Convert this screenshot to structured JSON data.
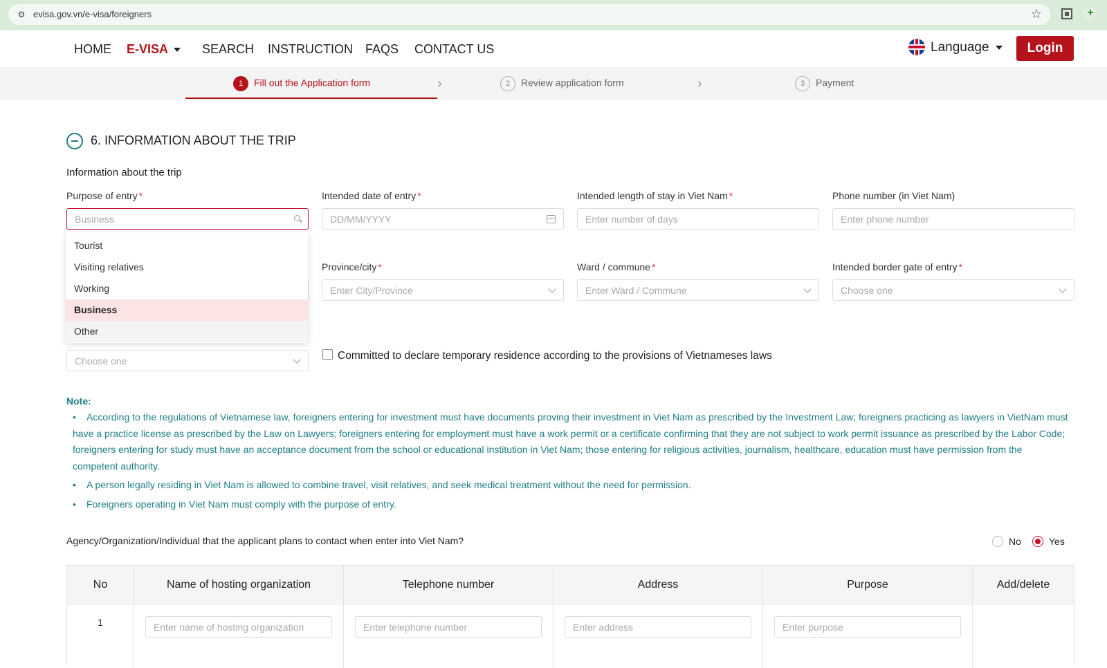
{
  "browser": {
    "url": "evisa.gov.vn/e-visa/foreigners"
  },
  "nav": {
    "home": "HOME",
    "evisa": "E-VISA",
    "search": "SEARCH",
    "instruction": "INSTRUCTION",
    "faqs": "FAQS",
    "contact": "CONTACT US",
    "language": "Language",
    "login": "Login"
  },
  "steps": [
    {
      "num": "1",
      "label": "Fill out the Application form"
    },
    {
      "num": "2",
      "label": "Review application form"
    },
    {
      "num": "3",
      "label": "Payment"
    }
  ],
  "section": {
    "title": "6. INFORMATION ABOUT THE TRIP",
    "subtitle": "Information about the trip"
  },
  "fields": {
    "purpose": {
      "label": "Purpose of entry",
      "placeholder": "Business"
    },
    "date": {
      "label": "Intended date of entry",
      "placeholder": "DD/MM/YYYY"
    },
    "stay": {
      "label": "Intended length of stay in Viet Nam",
      "placeholder": "Enter number of days"
    },
    "phone": {
      "label": "Phone number (in Viet Nam)",
      "placeholder": "Enter phone number"
    },
    "province": {
      "label": "Province/city",
      "placeholder": "Enter City/Province"
    },
    "ward": {
      "label": "Ward / commune",
      "placeholder": "Enter Ward / Commune"
    },
    "border": {
      "label": "Intended border gate of entry",
      "placeholder": "Choose one"
    },
    "choose": {
      "placeholder": "Choose one"
    },
    "required_mark": "*"
  },
  "dropdown": [
    "Tourist",
    "Visiting relatives",
    "Working",
    "Business",
    "Other"
  ],
  "checkbox_label": "Committed to declare temporary residence according to the provisions of Vietnameses laws",
  "note": {
    "title": "Note:",
    "items": [
      "According to the regulations of Vietnamese law, foreigners entering for investment must have documents proving their investment in Viet Nam as prescribed by the Investment Law; foreigners practicing as lawyers in VietNam must have a practice license as prescribed by the Law on Lawyers; foreigners entering for employment must have a work permit or a certificate confirming that they are not subject to work permit issuance as prescribed by the Labor Code; foreigners entering for study must have an acceptance document from the school or educational institution in Viet Nam; those entering for religious activities, journalism, healthcare, education must have permission from the competent authority.",
      "A person legally residing in Viet Nam is allowed to combine travel, visit relatives, and seek medical treatment without the need for permission.",
      "Foreigners operating in Viet Nam must comply with the purpose of entry."
    ]
  },
  "contact_question": {
    "text": "Agency/Organization/Individual that the applicant plans to contact when enter into Viet Nam?",
    "no": "No",
    "yes": "Yes"
  },
  "table": {
    "headers": [
      "No",
      "Name of hosting organization",
      "Telephone number",
      "Address",
      "Purpose",
      "Add/delete"
    ],
    "row_no": "1",
    "placeholders": {
      "name": "Enter name of hosting organization",
      "tel": "Enter telephone number",
      "address": "Enter address",
      "purpose": "Enter purpose"
    }
  },
  "colors": {
    "brand": "#b5121b",
    "note": "#1f7d87"
  }
}
